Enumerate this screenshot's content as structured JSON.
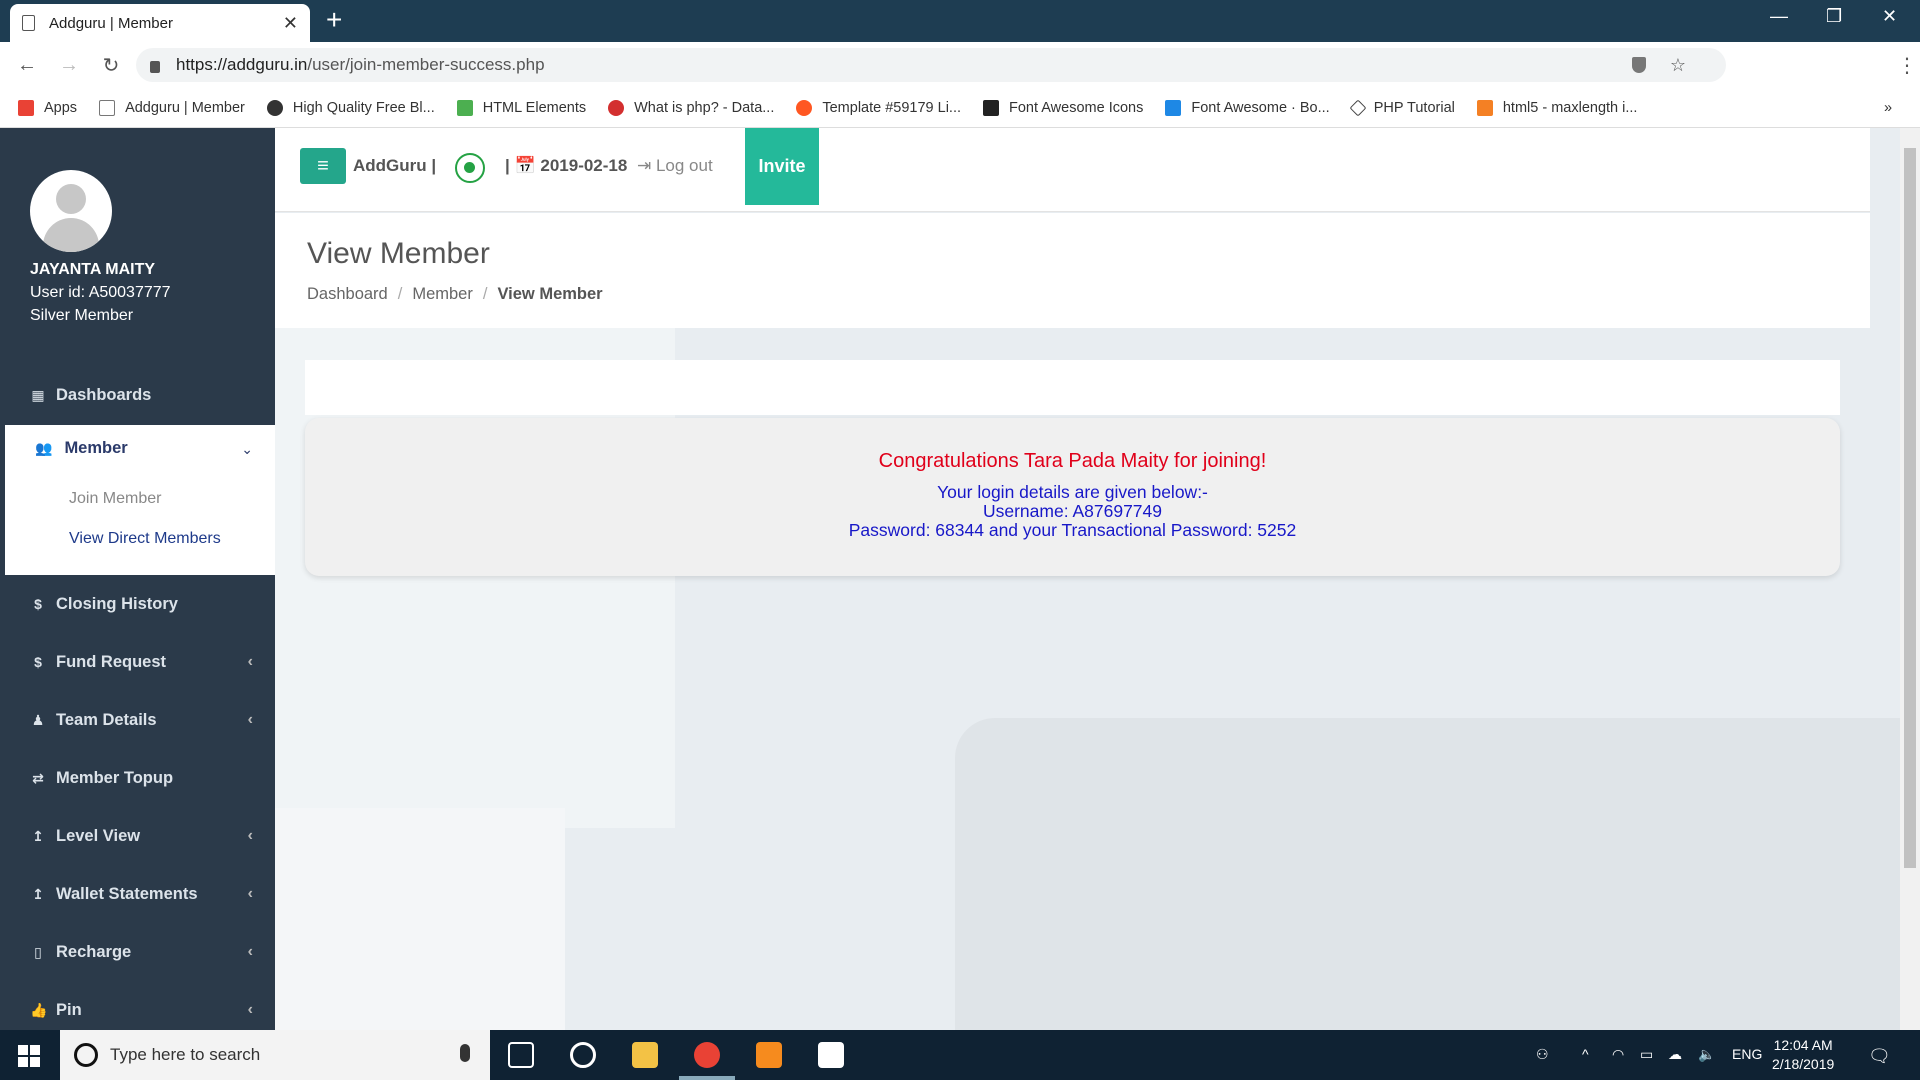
{
  "browser": {
    "tab_title": "Addguru | Member",
    "url_host": "https://addguru.in",
    "url_path": "/user/join-member-success.php",
    "bookmarks": [
      {
        "label": "Apps",
        "color": "#e94235"
      },
      {
        "label": "Addguru | Member",
        "color": "#888888"
      },
      {
        "label": "High Quality Free Bl...",
        "color": "#333333"
      },
      {
        "label": "HTML Elements",
        "color": "#4caf50"
      },
      {
        "label": "What is php? - Data...",
        "color": "#d32f2f"
      },
      {
        "label": "Template #59179 Li...",
        "color": "#ff5722"
      },
      {
        "label": "Font Awesome Icons",
        "color": "#222222"
      },
      {
        "label": "Font Awesome · Bo...",
        "color": "#1e88e5"
      },
      {
        "label": "PHP Tutorial",
        "color": "#444444"
      },
      {
        "label": "html5 - maxlength i...",
        "color": "#f48024"
      }
    ],
    "more": "»"
  },
  "sidebar": {
    "user_name": "JAYANTA MAITY",
    "user_id": "User id: A50037777",
    "membership": "Silver Member",
    "items": [
      {
        "label": "Dashboards",
        "icon": "▦"
      },
      {
        "label": "Closing History",
        "icon": "$"
      },
      {
        "label": "Fund Request",
        "icon": "$"
      },
      {
        "label": "Team Details",
        "icon": "♟"
      },
      {
        "label": "Member Topup",
        "icon": "⇄"
      },
      {
        "label": "Level View",
        "icon": "↥"
      },
      {
        "label": "Wallet Statements",
        "icon": "↥"
      },
      {
        "label": "Recharge",
        "icon": "▯"
      },
      {
        "label": "Pin",
        "icon": "👍"
      }
    ],
    "member": {
      "label": "Member",
      "sub_items": [
        "Join Member",
        "View Direct Members"
      ]
    }
  },
  "topnav": {
    "brand": "AddGuru |",
    "date": "| 📅 2019-02-18",
    "logout": "⇥  Log out",
    "invite": "Invite"
  },
  "page": {
    "title": "View Member",
    "breadcrumb": [
      "Dashboard",
      "Member",
      "View Member"
    ]
  },
  "message": {
    "congrats": "Congratulations Tara Pada Maity for joining!",
    "line1": "Your login details are given below:-",
    "line2": "Username: A87697749",
    "line3": "Password: 68344 and your Transactional Password: 5252"
  },
  "taskbar": {
    "search_placeholder": "Type here to search",
    "lang": "ENG",
    "time": "12:04 AM",
    "date": "2/18/2019"
  },
  "colors": {
    "sidebar_bg": "#2b3a4a",
    "accent": "#24b99a",
    "congrats": "#e0001a",
    "details": "#1818c8"
  }
}
